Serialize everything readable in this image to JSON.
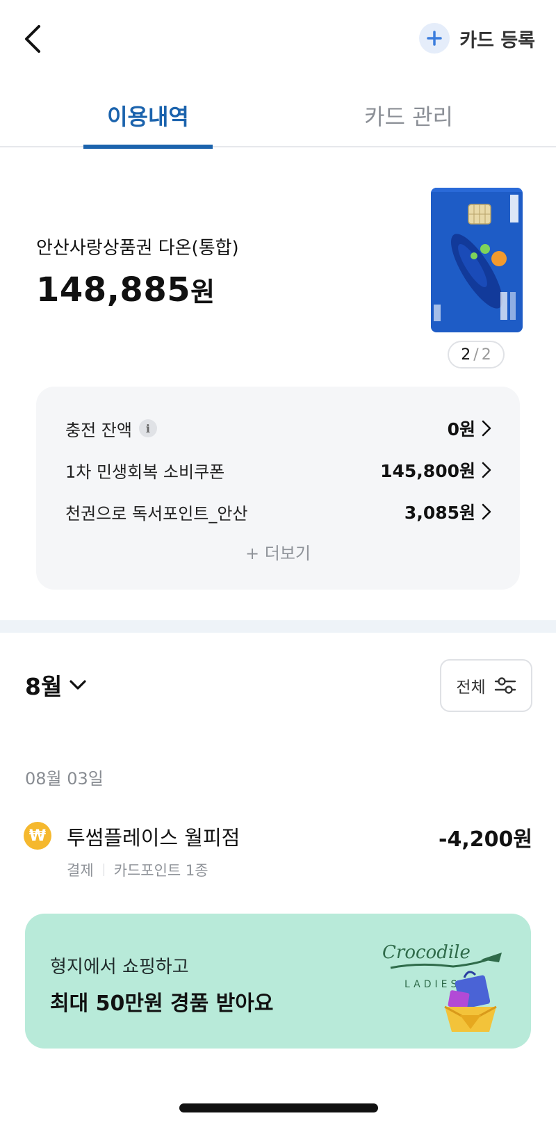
{
  "header": {
    "register_label": "카드 등록"
  },
  "tabs": [
    {
      "label": "이용내역",
      "active": true
    },
    {
      "label": "카드 관리",
      "active": false
    }
  ],
  "card": {
    "name": "안산사랑상품권  다온(통합)",
    "balance_number": "148,885",
    "balance_unit": "원",
    "pager_current": "2",
    "pager_separator": "/",
    "pager_total": "2"
  },
  "balances": {
    "items": [
      {
        "label": "충전 잔액",
        "value": "0원",
        "has_info": true
      },
      {
        "label": "1차 민생회복 소비쿠폰",
        "value": "145,800원",
        "has_info": false
      },
      {
        "label": "천권으로 독서포인트_안산",
        "value": "3,085원",
        "has_info": false
      }
    ],
    "info_icon_glyph": "i",
    "more_label": "+ 더보기"
  },
  "history": {
    "month_label": "8월",
    "filter_label": "전체",
    "date_header": "08월 03일",
    "transactions": [
      {
        "icon_glyph": "₩",
        "merchant": "투썸플레이스 월피점",
        "amount": "-4,200원",
        "type": "결제",
        "point_info": "카드포인트 1종"
      }
    ]
  },
  "banner": {
    "line1": "형지에서 쇼핑하고",
    "line2": "최대 50만원 경품 받아요",
    "brand_text": "Crocodile",
    "brand_sub": "LADIES"
  },
  "colors": {
    "accent": "#1b63ad",
    "banner_bg": "#b8ead9",
    "card_blue": "#1e5cc6",
    "coin": "#f5b82e"
  }
}
